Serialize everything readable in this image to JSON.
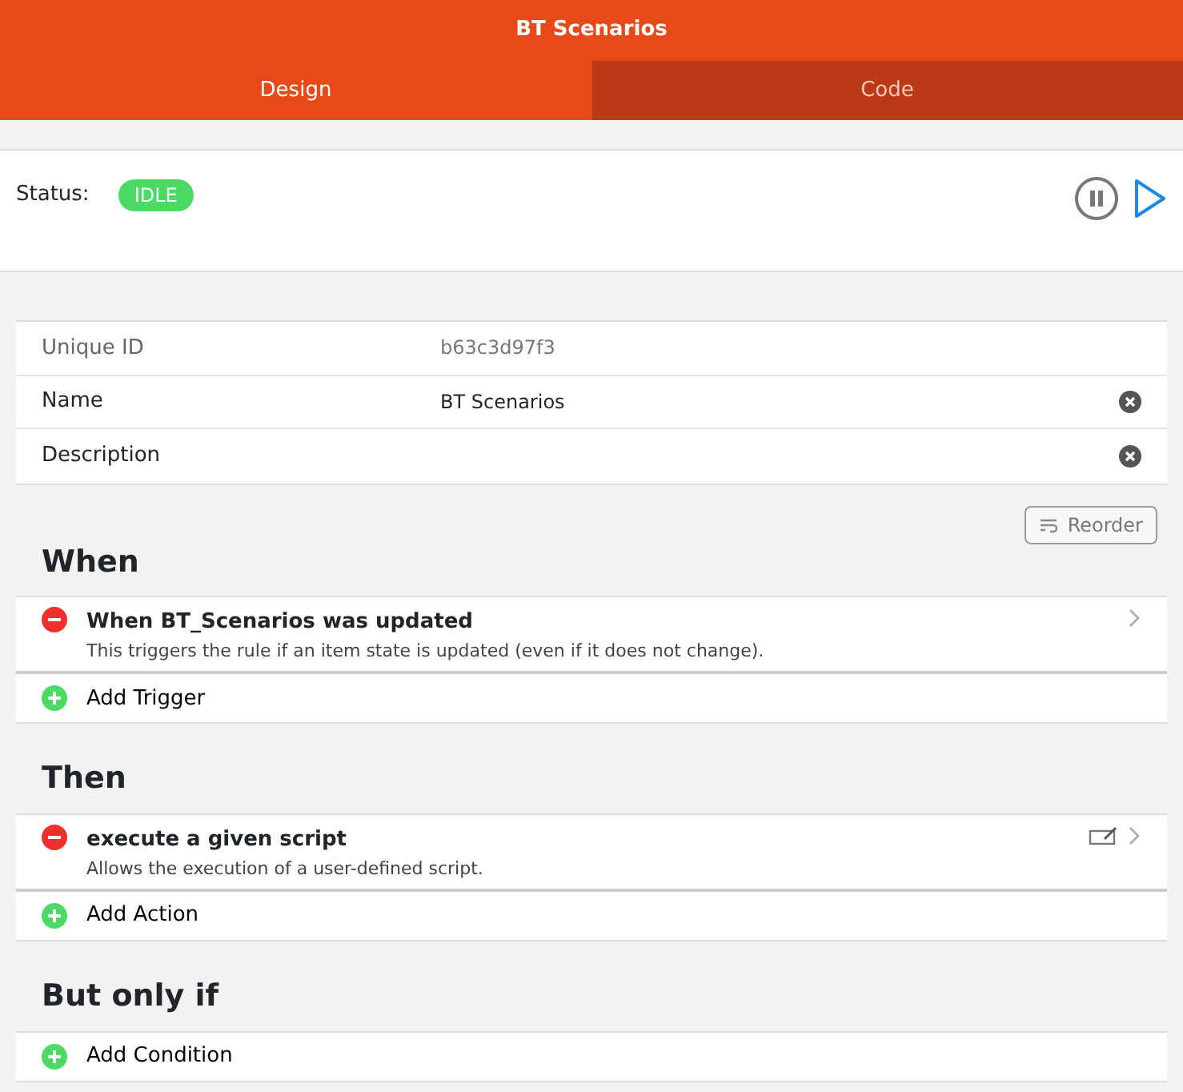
{
  "navbar": {
    "title": "BT Scenarios"
  },
  "tabs": [
    {
      "label": "Design",
      "selected": true
    },
    {
      "label": "Code",
      "selected": false
    }
  ],
  "status": {
    "label": "Status:",
    "value": "IDLE",
    "color": "#4cd964"
  },
  "properties": [
    {
      "label": "Unique ID",
      "value": "b63c3d97f3",
      "kind": "readonly"
    },
    {
      "label": "Name",
      "value": "BT Scenarios",
      "kind": "editable"
    },
    {
      "label": "Description",
      "kind": "editable"
    }
  ],
  "reorder_button": "Reorder",
  "sections": [
    {
      "title": "When",
      "items": [
        {
          "kind": "module",
          "title": "When BT_Scenarios was updated",
          "description": "This triggers the rule if an item state is updated (even if it does not change)."
        }
      ],
      "add_label": "Add Trigger"
    },
    {
      "title": "Then",
      "items": [
        {
          "kind": "script",
          "title": "execute a given script",
          "description": "Allows the execution of a user-defined script."
        }
      ],
      "add_label": "Add Action"
    },
    {
      "title": "But only if",
      "add_label": "Add Condition"
    }
  ]
}
